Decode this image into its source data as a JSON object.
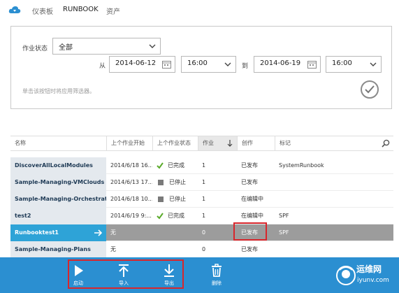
{
  "nav": {
    "items": [
      "仪表板",
      "RUNBOOK",
      "资产"
    ]
  },
  "filter": {
    "status_label": "作业状态",
    "status_value": "全部",
    "from_label": "从",
    "from_date": "2014-06-12",
    "from_time": "16:00",
    "to_label": "到",
    "to_date": "2014-06-19",
    "to_time": "16:00",
    "hint": "单击该按钮时将应用筛选器。"
  },
  "table": {
    "headers": [
      "名称",
      "上个作业开始",
      "上个作业状态",
      "作业",
      "创作",
      "标记"
    ],
    "rows": [
      {
        "name": "DiscoverAllLocalModules",
        "start": "2014/6/18 16...",
        "status": "已完成",
        "status_kind": "done",
        "jobs": "1",
        "authoring": "已发布",
        "tags": "SystemRunbook"
      },
      {
        "name": "Sample-Managing-VMClouds",
        "start": "2014/6/13 17...",
        "status": "已停止",
        "status_kind": "stopped",
        "jobs": "1",
        "authoring": "已发布",
        "tags": ""
      },
      {
        "name": "Sample-Managing-Orchestrator",
        "start": "2014/6/18 10...",
        "status": "已停止",
        "status_kind": "stopped",
        "jobs": "1",
        "authoring": "在编辑中",
        "tags": ""
      },
      {
        "name": "test2",
        "start": "2014/6/19 9:...",
        "status": "已完成",
        "status_kind": "done",
        "jobs": "1",
        "authoring": "在编辑中",
        "tags": "SPF"
      },
      {
        "name": "Runbooktest1",
        "start": "无",
        "status": "",
        "status_kind": "none",
        "jobs": "0",
        "authoring": "已发布",
        "tags": "SPF",
        "selected": true
      },
      {
        "name": "Sample-Managing-Plans",
        "start": "无",
        "status": "",
        "status_kind": "none",
        "jobs": "0",
        "authoring": "已发布",
        "tags": ""
      }
    ]
  },
  "commands": [
    "启动",
    "导入",
    "导出",
    "删除"
  ],
  "watermark": {
    "title": "运维网",
    "sub": "iyunv.com"
  },
  "colors": {
    "bar": "#2b8fd1",
    "selected_name": "#2ea3d7",
    "selected_row": "#9c9c9c",
    "highlight": "#d8262c",
    "done_check": "#5aaa2a"
  }
}
